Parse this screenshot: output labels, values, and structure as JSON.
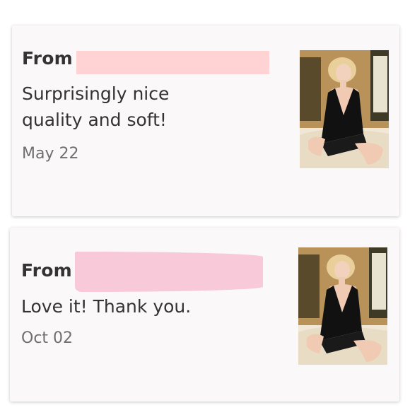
{
  "reviews": [
    {
      "from_label": "From",
      "message_lines": [
        "Surprisingly nice",
        "quality and soft!"
      ],
      "date": "May 22"
    },
    {
      "from_label": "From",
      "message_lines": [
        "Love it! Thank you."
      ],
      "date": "Oct 02"
    }
  ],
  "colors": {
    "card_bg": "#fbf8f9",
    "text": "#333333",
    "date_text": "#6f6f6f",
    "redaction_1": "#ffd3d3",
    "redaction_2": "#f8c9d9"
  }
}
